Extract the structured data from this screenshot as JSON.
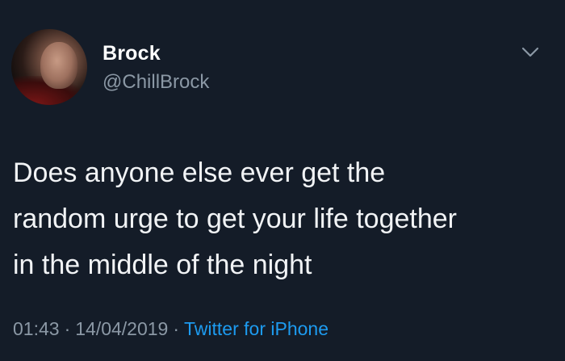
{
  "user": {
    "display_name": "Brock",
    "handle": "@ChillBrock"
  },
  "tweet": {
    "text_lines": [
      "Does anyone else ever get the",
      "random urge to get your life together",
      "in the middle of the night"
    ]
  },
  "meta": {
    "time": "01:43",
    "separator": "·",
    "date": "14/04/2019",
    "source": "Twitter for iPhone"
  },
  "icons": {
    "menu": "chevron-down-icon"
  },
  "colors": {
    "background": "#141c28",
    "text": "#f1f3f5",
    "secondary": "#8b98a5",
    "link": "#1d9bf0"
  }
}
